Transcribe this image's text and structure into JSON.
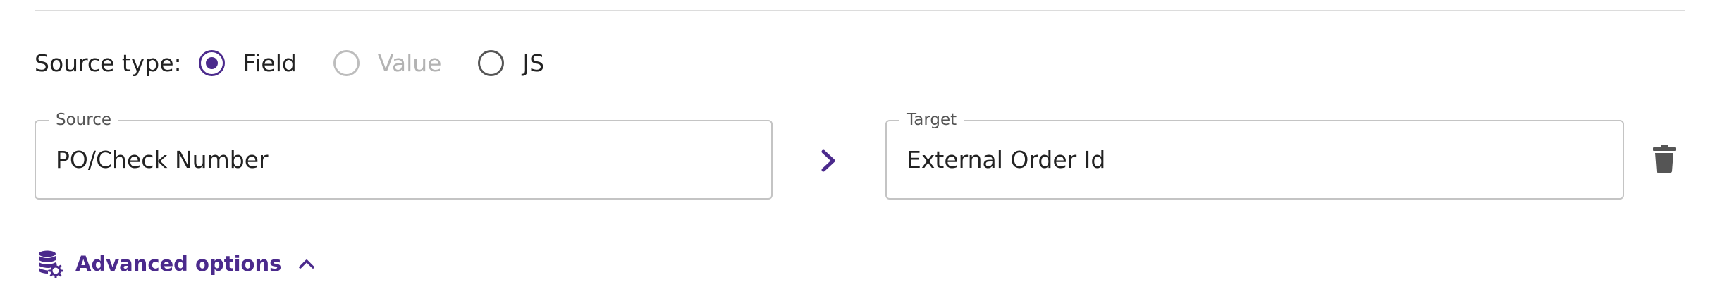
{
  "source_type": {
    "label": "Source type:",
    "options": [
      {
        "label": "Field",
        "state": "checked"
      },
      {
        "label": "Value",
        "state": "disabled"
      },
      {
        "label": "JS",
        "state": "unchecked"
      }
    ]
  },
  "source_field": {
    "legend": "Source",
    "value": "PO/Check Number"
  },
  "target_field": {
    "legend": "Target",
    "value": "External Order Id"
  },
  "icons": {
    "map_arrow": "chevron-right-icon",
    "delete": "trash-icon",
    "advanced": "database-gear-icon",
    "collapse": "chevron-up-icon"
  },
  "advanced_options": {
    "label": "Advanced options",
    "expanded": true
  },
  "colors": {
    "accent": "#4b2a8c",
    "border": "#c4c4c4",
    "disabled": "#b3b3b3",
    "icon_gray": "#555555"
  }
}
